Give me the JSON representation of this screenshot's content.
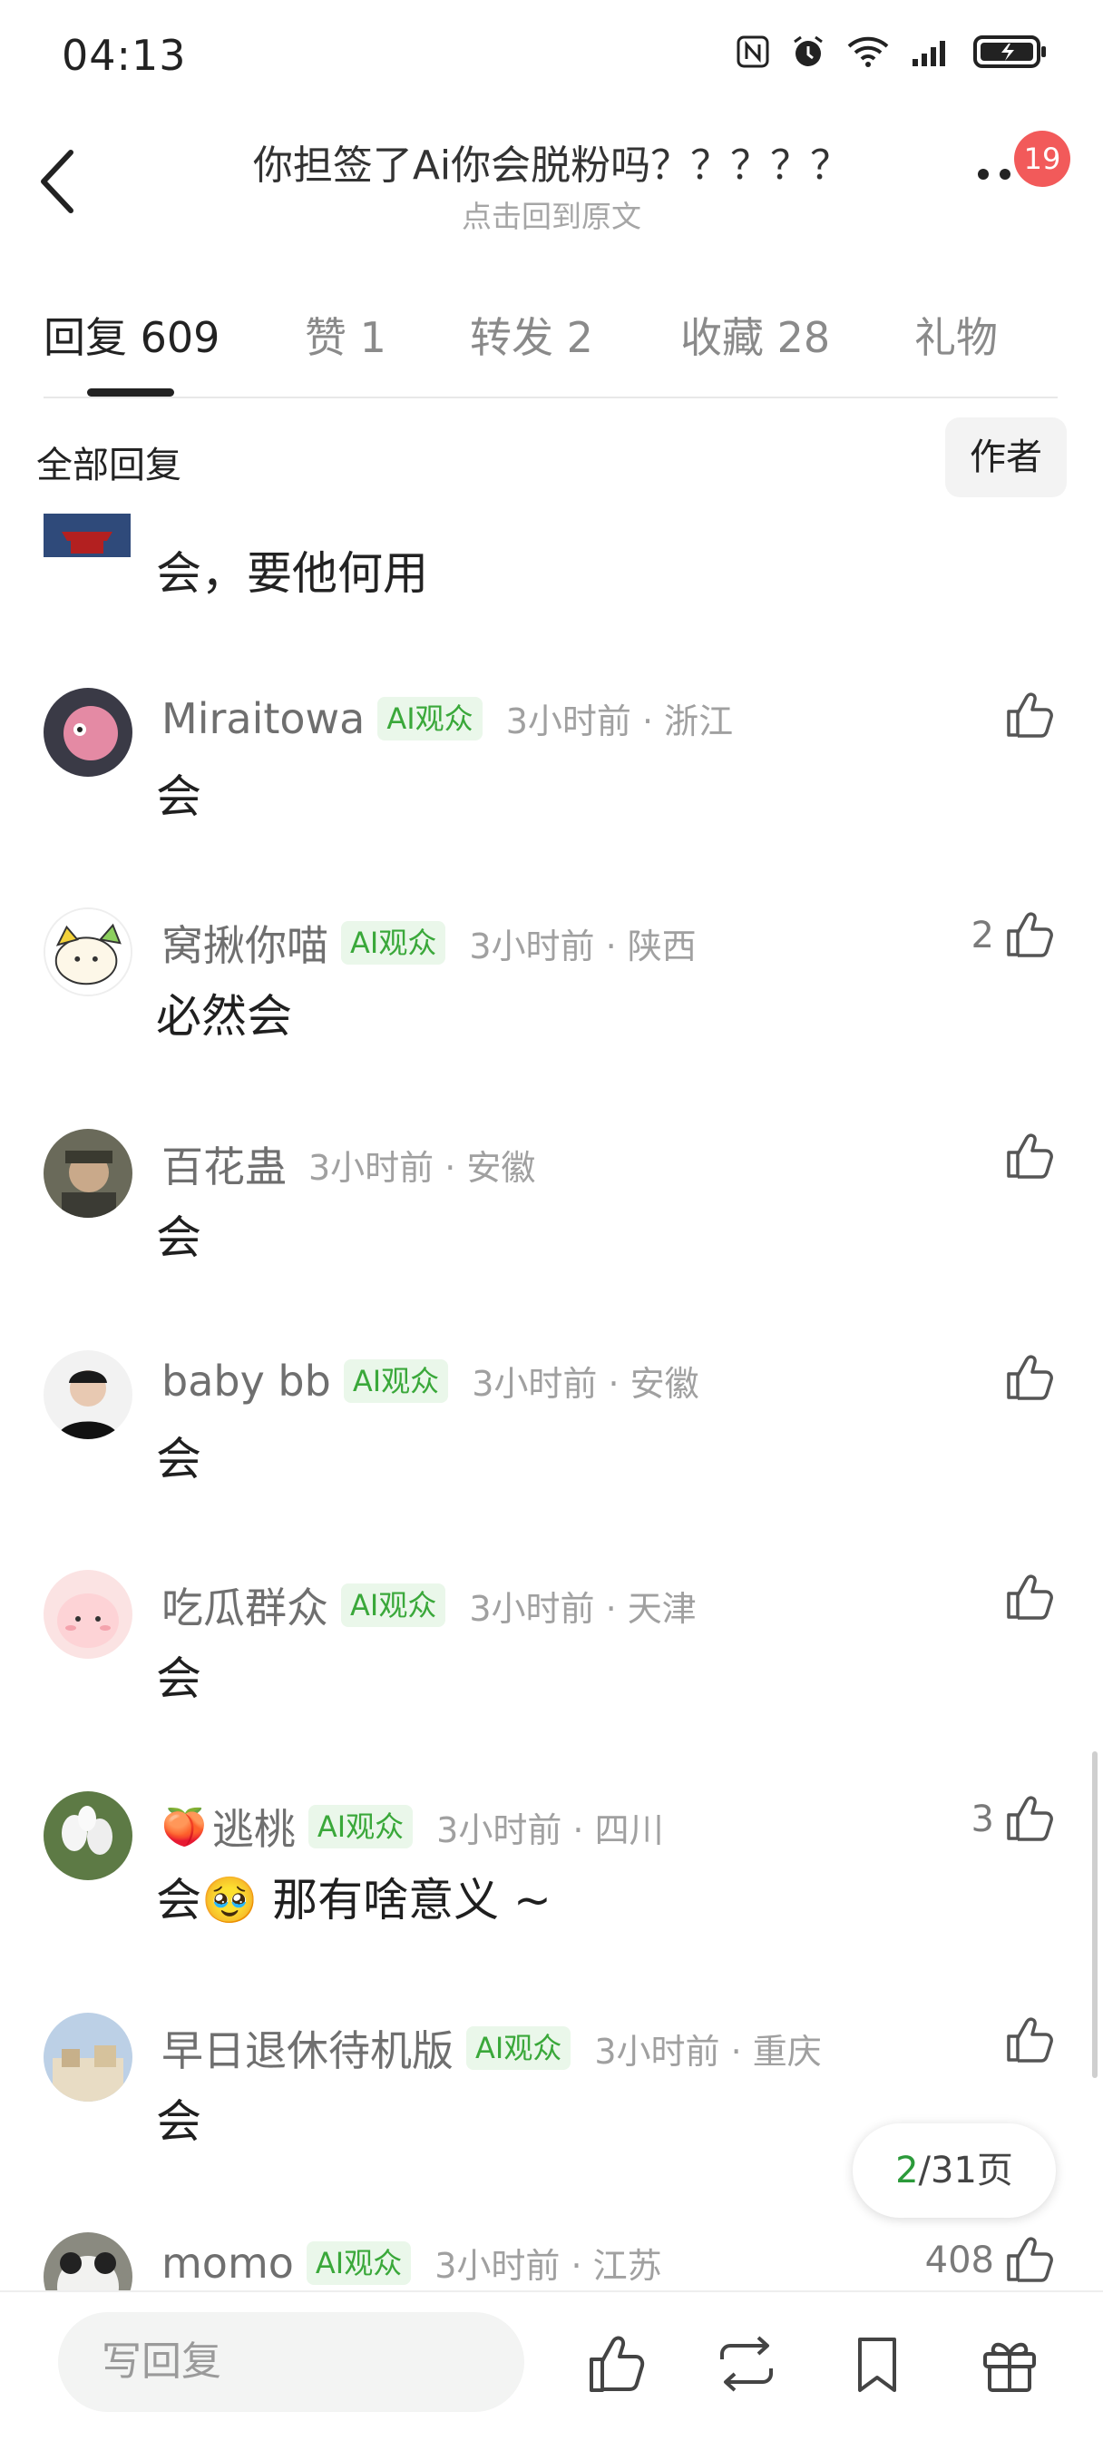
{
  "status_bar": {
    "time": "04:13"
  },
  "header": {
    "title": "你担签了Ai你会脱粉吗？？？？？",
    "subtitle": "点击回到原文",
    "notification_count": "19"
  },
  "tabs": [
    {
      "label": "回复 609",
      "active": true
    },
    {
      "label": "赞 1",
      "active": false
    },
    {
      "label": "转发 2",
      "active": false
    },
    {
      "label": "收藏 28",
      "active": false
    },
    {
      "label": "礼物",
      "active": false
    }
  ],
  "filter": {
    "label": "全部回复",
    "author_button": "作者"
  },
  "partial_comment": {
    "text": "会，要他何用"
  },
  "comments": [
    {
      "username": "Miraitowa",
      "tag": "AI观众",
      "time": "3小时前 · 浙江",
      "text": "会",
      "likes": ""
    },
    {
      "username": "窝揪你喵",
      "tag": "AI观众",
      "time": "3小时前 · 陕西",
      "text": "必然会",
      "likes": "2"
    },
    {
      "username": "百花蛊",
      "tag": "",
      "time": "3小时前 · 安徽",
      "text": "会",
      "likes": ""
    },
    {
      "username": "baby bb",
      "tag": "AI观众",
      "time": "3小时前 · 安徽",
      "text": "会",
      "likes": ""
    },
    {
      "username": "吃瓜群众",
      "tag": "AI观众",
      "time": "3小时前 · 天津",
      "text": "会",
      "likes": ""
    },
    {
      "username": "逃桃",
      "tag": "AI观众",
      "time": "3小时前 · 四川",
      "text": "会🥹 那有啥意义 ~",
      "likes": "3"
    },
    {
      "username": "早日退休待机版",
      "tag": "AI观众",
      "time": "3小时前 · 重庆",
      "text": "会",
      "likes": ""
    },
    {
      "username": "momo",
      "tag": "AI观众",
      "time": "3小时前 · 江苏",
      "text": "",
      "likes": "408"
    }
  ],
  "pager": {
    "current": "2",
    "total": "/31页"
  },
  "bottom_bar": {
    "reply_placeholder": "写回复"
  },
  "colors": {
    "accent_green": "#2b9a3a",
    "badge_red": "#f25a5a",
    "tag_bg": "#eaf7ea"
  }
}
